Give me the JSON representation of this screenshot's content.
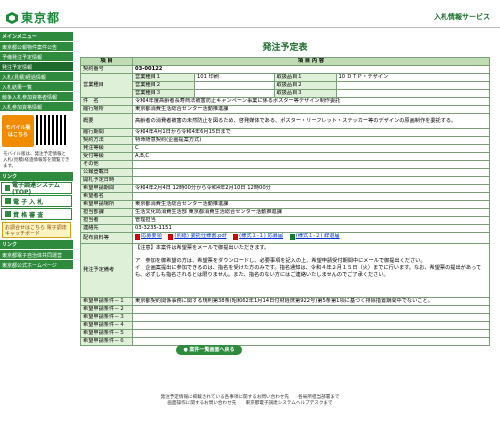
{
  "header": {
    "logo_text": "東京都",
    "site_title": "入札情報サービス"
  },
  "sidebar": {
    "menu_heading": "メインメニュー",
    "items": [
      {
        "label": "東京都公報物件案件公告"
      },
      {
        "label": "予備発注予定情報"
      },
      {
        "label": "発注予定情報"
      },
      {
        "label": "入札(見積)経過情報"
      },
      {
        "label": "入札結果一覧"
      },
      {
        "label": "競争入札参加資格者情報"
      },
      {
        "label": "入札参加資格情報"
      }
    ],
    "mobile_button": "モバイル版",
    "mobile_sub": "はこちら",
    "mobile_note": "モバイル版は、発注予定情報と入札(見積)経過情報等を閲覧できます。",
    "link_heading": "リンク",
    "big_links": [
      {
        "label": "電子調達システム(TOP)"
      },
      {
        "label": "電 子 入 札"
      },
      {
        "label": "資 格 審 査"
      }
    ],
    "kids_link": "お調合せはこちら 電子調達キャッチボード",
    "bottom_heading": "リンク",
    "bottom_items": [
      {
        "label": "東京都電子自治体共同運営"
      },
      {
        "label": "東京都公式ホームページ"
      }
    ]
  },
  "main": {
    "title": "発注予定表",
    "col_item": "項 目",
    "col_content": "項 目 内 容",
    "contract_no_label": "契約番号",
    "contract_no": "03-00122",
    "business_label": "営業種目",
    "business": [
      [
        "営業種目１",
        "101 印刷",
        "取扱品目１",
        "10 ＤＴＰ・デザイン"
      ],
      [
        "営業種目２",
        "",
        "取扱品目２",
        ""
      ],
      [
        "営業種目３",
        "",
        "取扱品目３",
        ""
      ]
    ],
    "rows": [
      {
        "label": "件　名",
        "value": "令和4年度高齢者長寿商法被害防止キャンペーン事業に係るポスター等デザイン制作委託"
      },
      {
        "label": "履行場所",
        "value": "東京都消費生活総合センター活動推進課"
      },
      {
        "label": "概要",
        "value": "高齢者の消費者被害の未然防止を図るため、啓発媒体である、ポスター・リーフレット・ステッカー等のデザインの原画制作を委託する。"
      },
      {
        "label": "履行期間",
        "value": "令和4年4月1日から令和4年6月15日まで"
      },
      {
        "label": "契約方法",
        "value": "特命随意契約(企画提案方式)"
      },
      {
        "label": "発注等級",
        "value": "C"
      },
      {
        "label": "受付等級",
        "value": "A,B,C"
      },
      {
        "label": "その他",
        "value": ""
      },
      {
        "label": "公報登載日",
        "value": ""
      },
      {
        "label": "開札予定日時",
        "value": ""
      },
      {
        "label": "希望申請期間",
        "value": "令和4年2月4日 12時00分から令和4年2月10日 12時00分"
      },
      {
        "label": "希望者名",
        "value": ""
      },
      {
        "label": "希望申請場所",
        "value": "東京都消費生活総合センター活動推進課"
      },
      {
        "label": "担当部課",
        "value": "生活文化局消費生活部 東京都消費生活総合センター活動推進課"
      },
      {
        "label": "担当者",
        "value": "管理担当"
      },
      {
        "label": "連絡先",
        "value": "03-3235-1151"
      }
    ],
    "files_label": "配布資料等",
    "files": [
      "応募要領",
      "(別紙) 委託仕様書.pdf",
      "(様式１-１) 応募届",
      "(様式１-２) 辞退届"
    ],
    "notes_label": "発注予定備考",
    "notes": [
      "【注意】本案件は希望票をメールで御提出いただきます。",
      "ア　参加を御希望の方は、希望票をダウンロードし、必要事項を記入の上、希望申請受付期間中にメールで御提出ください。",
      "イ　企画案提出に参加できるのは、指名を受けた方のみです。指名通知は、令和４年２月１５日（火）までに行います。なお、希望票の提出があっても、必ずしも指名されるとは限りません。また、指名のない方にはご連絡いたしませんのでご了承ください。"
    ],
    "conditions": [
      {
        "label": "希望申請条件－１",
        "value": "東京都契約関係事務に関する規則第38条(昭和62年1月14日付財経庶第922号)第5条第1項に基づく排除措置期間中でないこと。"
      },
      {
        "label": "希望申請条件－２",
        "value": ""
      },
      {
        "label": "希望申請条件－３",
        "value": ""
      },
      {
        "label": "希望申請条件－４",
        "value": ""
      },
      {
        "label": "希望申請条件－５",
        "value": ""
      },
      {
        "label": "希望申請条件－６",
        "value": ""
      }
    ],
    "back_button": "● 案件一覧画面へ戻る"
  },
  "footer": {
    "line1": "発注予定情報に掲載されている各事項に関するお問い合わせ先　　各局所担当部署まで",
    "line2": "画面操作に関するお問い合わせ先　　東京都電子調達システムヘルプデスクまで"
  }
}
